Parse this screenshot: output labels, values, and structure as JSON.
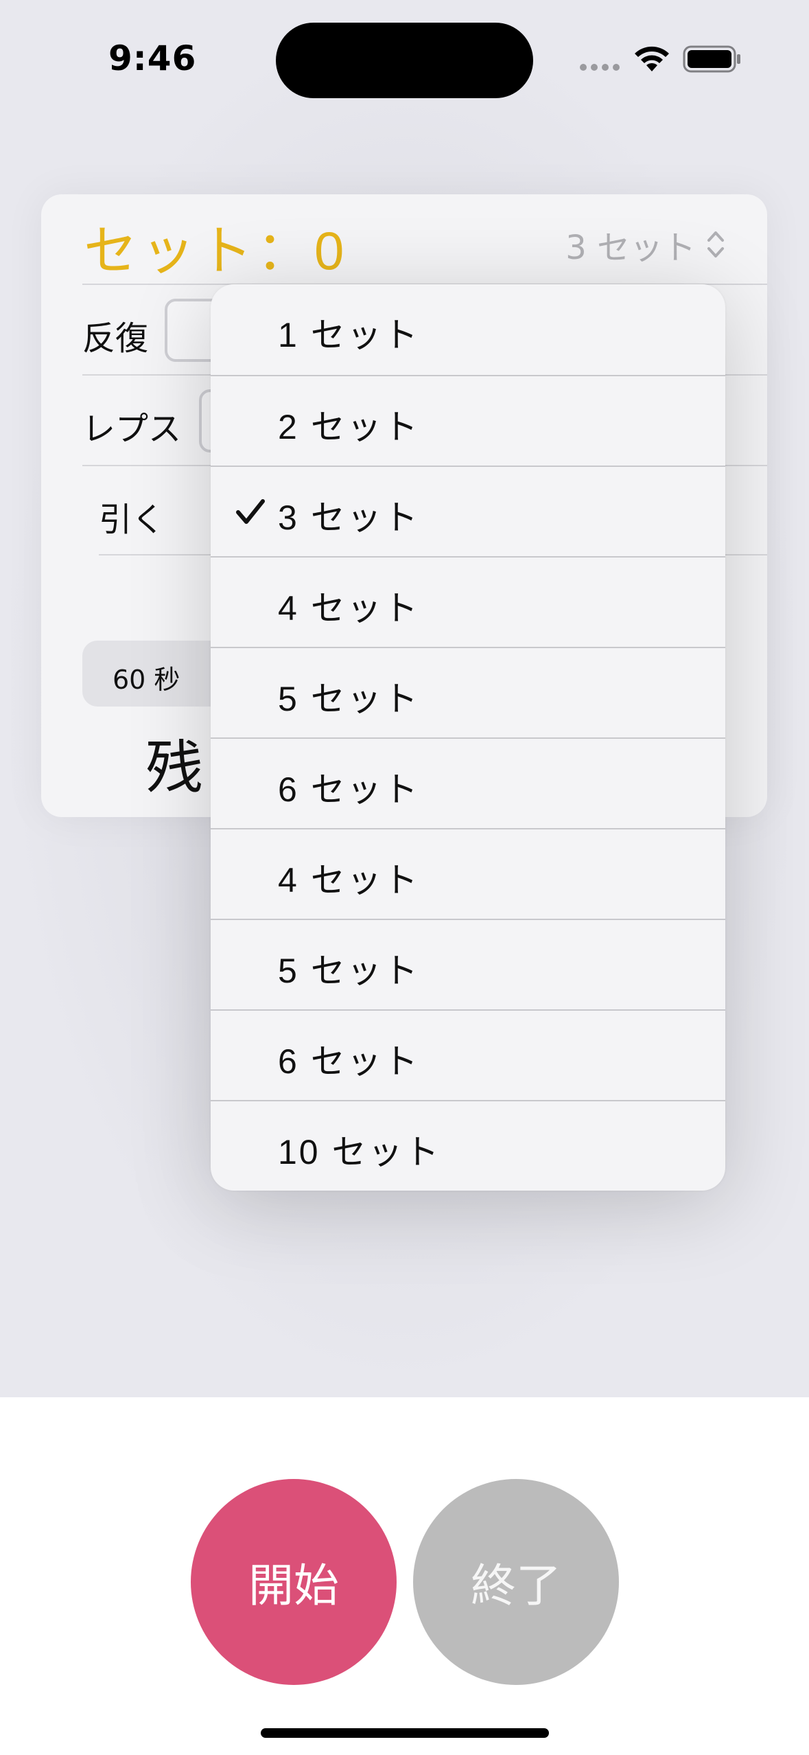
{
  "status_bar": {
    "time": "9:46"
  },
  "card": {
    "title": "セット：0",
    "sets_picker_value": "3 セット",
    "rows": {
      "repeat_label": "反復",
      "reps_label": "レプス",
      "pull_label": "引く"
    },
    "segment": {
      "selected": "60 秒"
    },
    "remaining_char": "残"
  },
  "menu": {
    "items": [
      {
        "label": "1 セット",
        "checked": false
      },
      {
        "label": "2 セット",
        "checked": false
      },
      {
        "label": "3 セット",
        "checked": true
      },
      {
        "label": "4 セット",
        "checked": false
      },
      {
        "label": "5 セット",
        "checked": false
      },
      {
        "label": "6 セット",
        "checked": false
      },
      {
        "label": "4 セット",
        "checked": false
      },
      {
        "label": "5 セット",
        "checked": false
      },
      {
        "label": "6 セット",
        "checked": false
      },
      {
        "label": "10 セット",
        "checked": false
      }
    ]
  },
  "buttons": {
    "start_label": "開始",
    "end_label": "終了"
  },
  "colors": {
    "accent_yellow": "#e6b41a",
    "start_pink": "#db5078",
    "end_gray": "#bbbbbb"
  }
}
